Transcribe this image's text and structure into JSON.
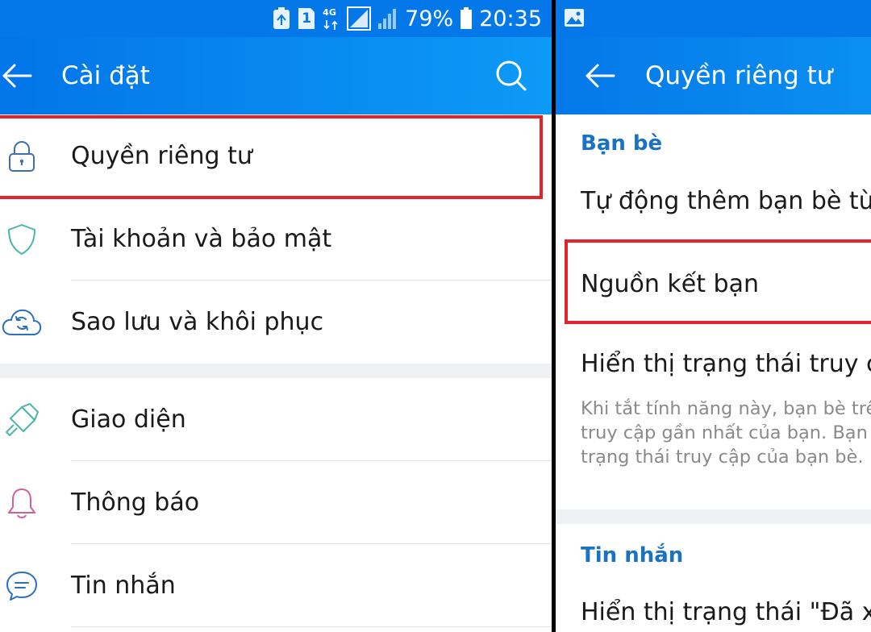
{
  "status_bar": {
    "sim_badge": "1",
    "network_type": "4G",
    "battery_percent": "79%",
    "time": "20:35"
  },
  "settings_screen": {
    "title": "Cài đặt",
    "items": [
      {
        "label": "Quyền riêng tư",
        "icon": "lock-icon"
      },
      {
        "label": "Tài khoản và bảo mật",
        "icon": "shield-icon"
      },
      {
        "label": "Sao lưu và khôi phục",
        "icon": "cloud-sync-icon"
      },
      {
        "label": "Giao diện",
        "icon": "paint-brush-icon"
      },
      {
        "label": "Thông báo",
        "icon": "bell-icon"
      },
      {
        "label": "Tin nhắn",
        "icon": "chat-bubble-icon"
      }
    ]
  },
  "privacy_screen": {
    "title": "Quyền riêng tư",
    "friends_section": {
      "title": "Bạn bè",
      "items": [
        "Tự động thêm bạn bè từ d",
        "Nguồn kết bạn",
        "Hiển thị trạng thái truy cập"
      ],
      "description": [
        "Khi tắt tính năng này, bạn bè trên",
        "truy cập gần nhất của bạn. Bạn",
        "trạng thái truy cập của bạn bè."
      ]
    },
    "messages_section": {
      "title": "Tin nhắn",
      "items": [
        "Hiển thị trạng thái \"Đã xem"
      ]
    }
  },
  "colors": {
    "header_blue": "#0478e8",
    "section_title_blue": "#1a73c2",
    "highlight_red": "#e3222b"
  }
}
